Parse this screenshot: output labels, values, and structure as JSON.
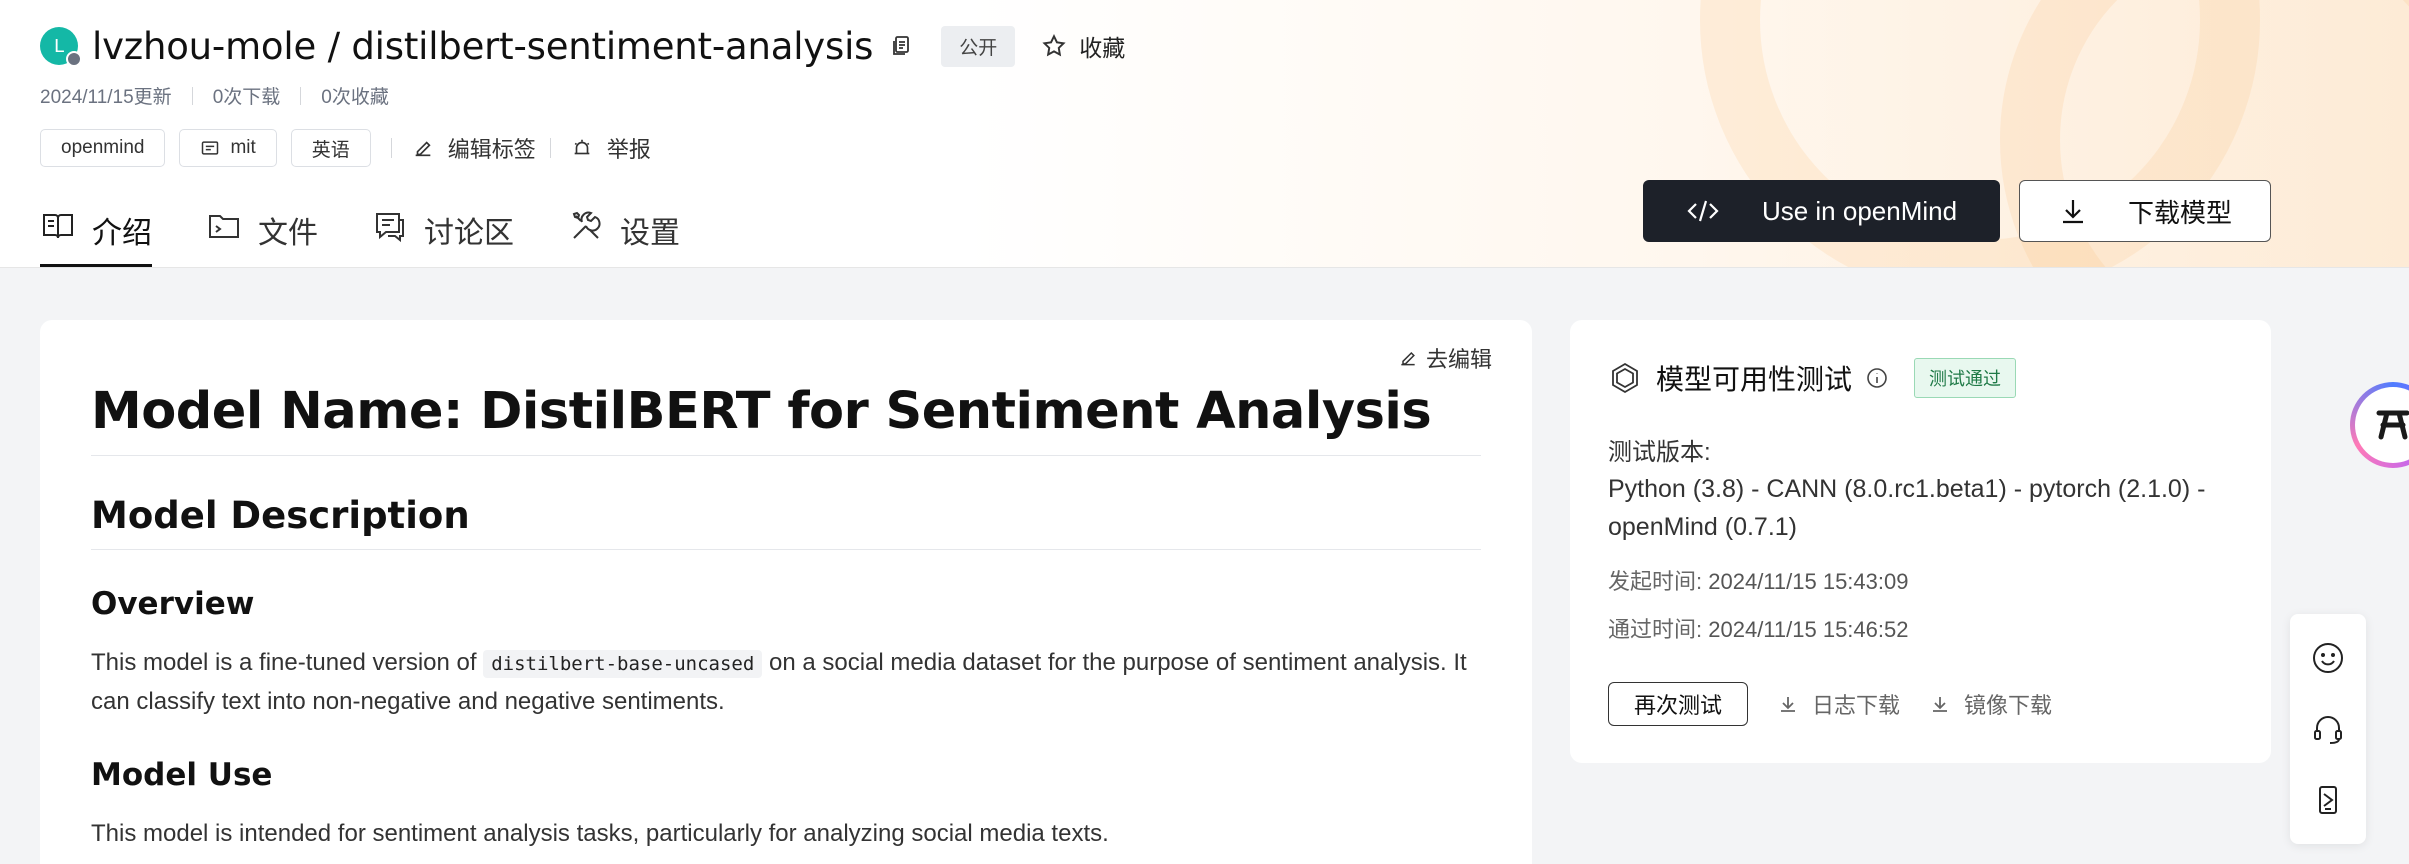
{
  "repo": {
    "avatar_letter": "L",
    "title": "lvzhou-mole / distilbert-sentiment-analysis",
    "visibility": "公开",
    "favorite_label": "收藏",
    "updated": "2024/11/15更新",
    "downloads": "0次下载",
    "favorites": "0次收藏"
  },
  "tags": {
    "items": [
      "openmind",
      "mit",
      "英语"
    ],
    "edit_label": "编辑标签",
    "report_label": "举报"
  },
  "tabs": [
    {
      "label": "介绍",
      "icon": "book-icon",
      "active": true
    },
    {
      "label": "文件",
      "icon": "folder-icon"
    },
    {
      "label": "讨论区",
      "icon": "comment-icon"
    },
    {
      "label": "设置",
      "icon": "tools-icon"
    }
  ],
  "actions": {
    "use_label": "Use in openMind",
    "download_label": "下载模型"
  },
  "readme": {
    "edit_label": "去编辑",
    "h1": "Model Name: DistilBERT for Sentiment Analysis",
    "h2": "Model Description",
    "h3_overview": "Overview",
    "overview_before": "This model is a fine-tuned version of ",
    "overview_code": "distilbert-base-uncased",
    "overview_after": " on a social media dataset for the purpose of sentiment analysis. It can classify text into non-negative and negative sentiments.",
    "h3_use": "Model Use",
    "use_text": "This model is intended for sentiment analysis tasks, particularly for analyzing social media texts."
  },
  "availability": {
    "title": "模型可用性测试",
    "status": "测试通过",
    "version_label": "测试版本:",
    "version_value": "Python (3.8) - CANN (8.0.rc1.beta1) - pytorch (2.1.0) - openMind (0.7.1)",
    "start_label": "发起时间:",
    "start_value": "2024/11/15 15:43:09",
    "pass_label": "通过时间:",
    "pass_value": "2024/11/15 15:46:52",
    "retest_label": "再次测试",
    "log_download_label": "日志下载",
    "image_download_label": "镜像下载"
  },
  "colors": {
    "accent_dark": "#1d2129",
    "pass_green": "#1f7a47",
    "avatar_teal": "#14b8a6"
  }
}
